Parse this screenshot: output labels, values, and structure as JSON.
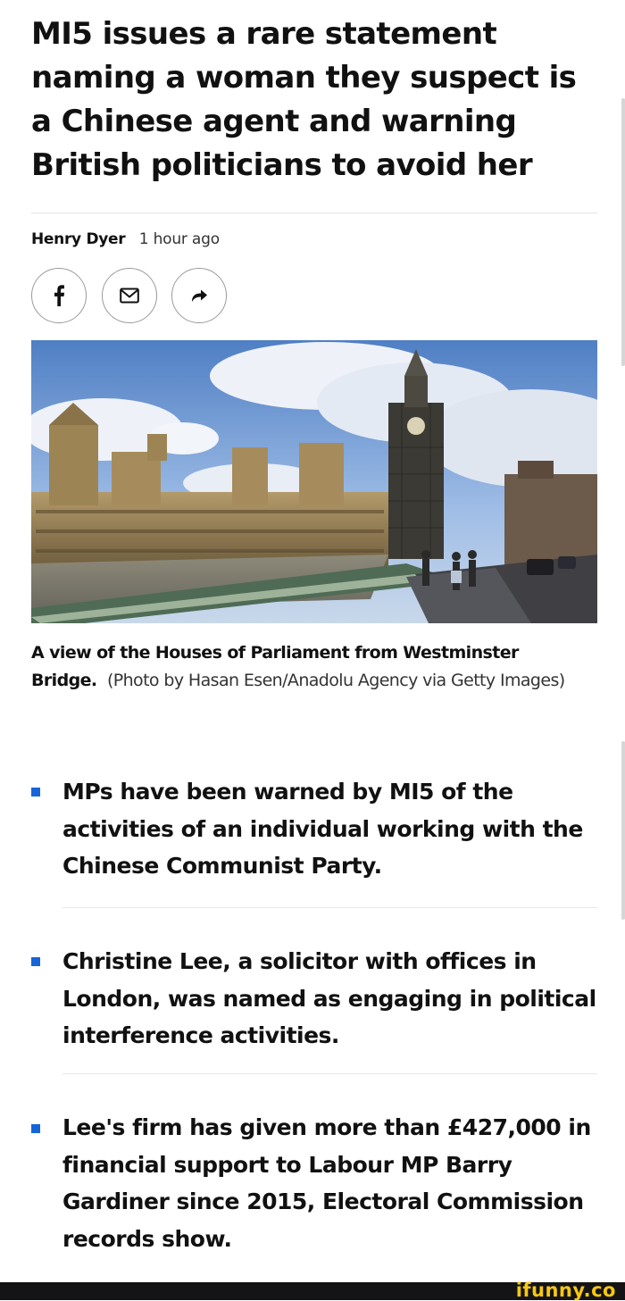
{
  "article": {
    "headline": "MI5 issues a rare statement naming a woman they suspect is a Chinese agent and warning British politicians to avoid her",
    "author": "Henry Dyer",
    "timestamp": "1 hour ago",
    "share": [
      {
        "icon": "facebook-icon"
      },
      {
        "icon": "email-icon"
      },
      {
        "icon": "share-arrow-icon"
      }
    ],
    "image": {
      "caption": "A view of the Houses of Parliament from Westminster Bridge.",
      "credit": "(Photo by Hasan Esen/Anadolu Agency via Getty Images)"
    },
    "bullets": [
      "MPs have been warned by MI5 of the activities of an individual working with the Chinese Communist Party.",
      "Christine Lee, a solicitor with offices in London, was named as engaging in political interference activities.",
      "Lee's firm has given more than £427,000 in financial support to Labour MP Barry Gardiner since 2015, Electoral Commission records show."
    ],
    "bullet_color": "#1665d8"
  },
  "watermark": "ifunny.co"
}
